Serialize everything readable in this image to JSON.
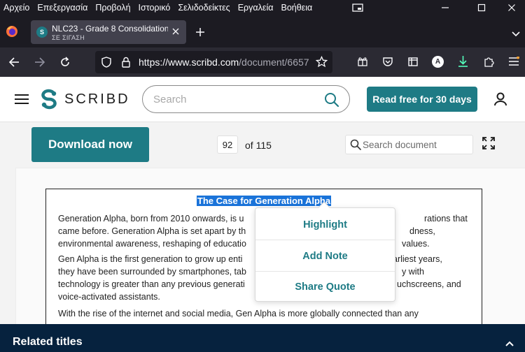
{
  "menubar": {
    "items": [
      "Αρχείο",
      "Επεξεργασία",
      "Προβολή",
      "Ιστορικό",
      "Σελιδοδείκτες",
      "Εργαλεία",
      "Βοήθεια"
    ]
  },
  "browser": {
    "tab_title": "NLC23 - Grade 8 Consolidation",
    "tab_subtitle": "ΣΕ ΣΙΓΑΣΗ",
    "favicon_letter": "S",
    "url_main": "https://www.scribd.com",
    "url_rest": "/document/6657",
    "profile_letter": "A"
  },
  "header": {
    "brand": "SCRIBD",
    "search_placeholder": "Search",
    "cta_label": "Read free for 30 days"
  },
  "toolbar": {
    "download_label": "Download now",
    "page_current": "92",
    "page_of": "of 115",
    "doc_search_placeholder": "Search document"
  },
  "document": {
    "title": "The Case for Generation Alpha",
    "lines": [
      "Generation Alpha, born from 2010 onwards, is u",
      "rations that",
      "came before. Generation Alpha is set apart by th",
      "dness,",
      "environmental awareness, reshaping of educatio",
      "values.",
      "Gen Alpha is the first generation to grow up enti",
      "arliest years,",
      "they have been surrounded by smartphones, tab",
      "y with",
      "technology is greater than any previous generati",
      "uchscreens, and",
      "voice-activated assistants.",
      "With the rise of the internet and social media, Gen Alpha is more globally connected than any"
    ]
  },
  "popup": {
    "items": [
      "Highlight",
      "Add Note",
      "Share Quote"
    ]
  },
  "footer": {
    "related_label": "Related titles"
  },
  "colors": {
    "brand_teal": "#1e7b85",
    "footer_navy": "#06223e",
    "selection_blue": "#1a73d9"
  }
}
